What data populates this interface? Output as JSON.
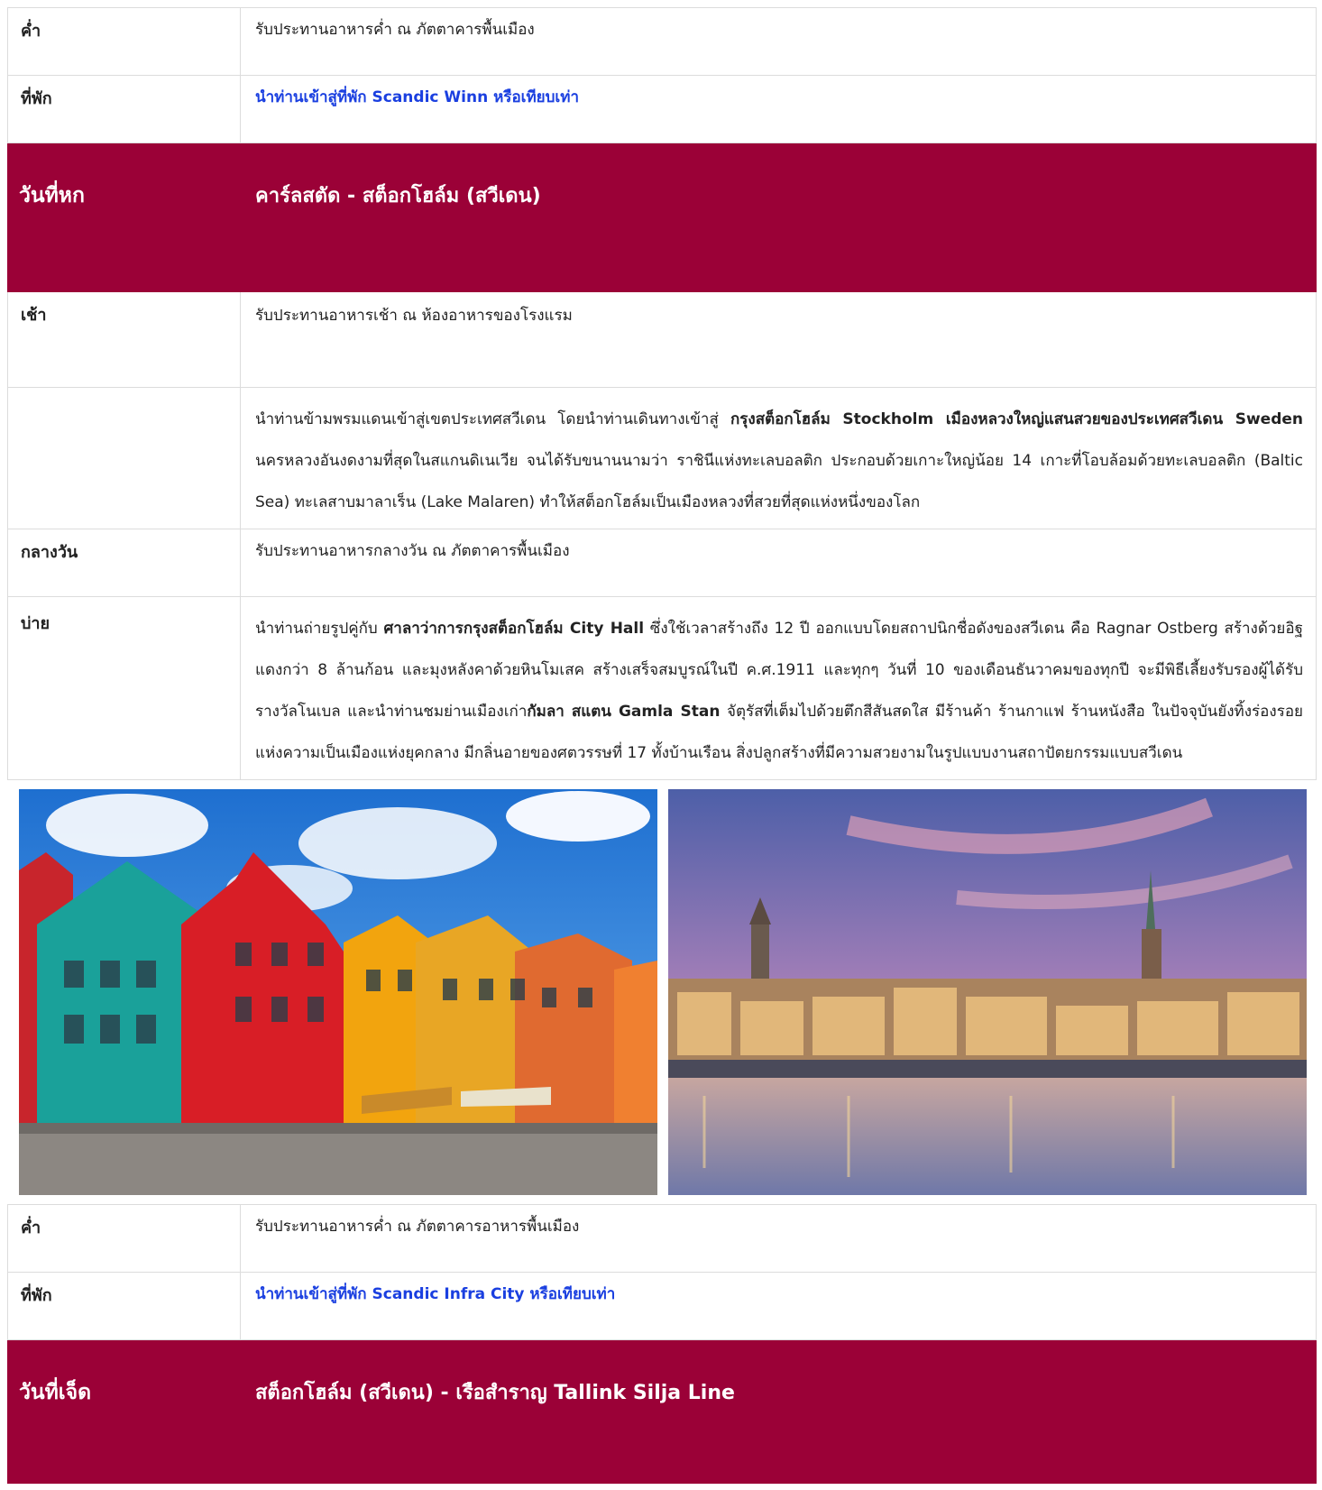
{
  "rows": {
    "dinner1": {
      "label": "ค่ำ",
      "text": "รับประทานอาหารค่ำ ณ ภัตตาคารพื้นเมือง"
    },
    "hotel1": {
      "label": "ที่พัก",
      "text": "นำท่านเข้าสู่ที่พัก Scandic Winn หรือเทียบเท่า"
    },
    "day6": {
      "label": "วันที่หก",
      "title": "คาร์ลสตัด - สต็อกโฮล์ม (สวีเดน)"
    },
    "breakfast": {
      "label": "เช้า",
      "text": "รับประทานอาหารเช้า ณ ห้องอาหารของโรงแรม"
    },
    "morning_para": {
      "p1": "นำท่านข้ามพรมแดนเข้าสู่เขตประเทศสวีเดน โดยนำท่านเดินทางเข้าสู่ ",
      "b1": "กรุงสต็อกโฮล์ม Stockholm เมืองหลวงใหญ่แสนสวยของประเทศสวีเดน Sweden",
      "p2": " นครหลวงอันงดงามที่สุดในสแกนดิเนเวีย จนได้รับขนานนามว่า ราชินีแห่งทะเลบอลติก ประกอบด้วยเกาะใหญ่น้อย 14 เกาะที่โอบล้อมด้วยทะเลบอลติก (Baltic Sea) ทะเลสาบมาลาเร็น (Lake Malaren) ทำให้สต็อกโฮล์มเป็นเมืองหลวงที่สวยที่สุดแห่งหนึ่งของโลก"
    },
    "lunch": {
      "label": "กลางวัน",
      "text": "รับประทานอาหารกลางวัน ณ ภัตตาคารพื้นเมือง"
    },
    "afternoon": {
      "label": "บ่าย",
      "p1": "นำท่านถ่ายรูปคู่กับ ",
      "b1": "ศาลาว่าการกรุงสต็อกโฮล์ม City Hall",
      "p2": " ซึ่งใช้เวลาสร้างถึง 12 ปี ออกแบบโดยสถาปนิกชื่อดังของสวีเดน คือ Ragnar Ostberg สร้างด้วยอิฐแดงกว่า 8 ล้านก้อน และมุงหลังคาด้วยหินโมเสค สร้างเสร็จสมบูรณ์ในปี ค.ศ.1911 และทุกๆ วันที่ 10 ของเดือนธันวาคมของทุกปี จะมีพิธีเลี้ยงรับรองผู้ได้รับรางวัลโนเบล และนำท่านชมย่านเมืองเก่า",
      "b2": "กัมลา สแตน Gamla Stan",
      "p3": " จัตุรัสที่เต็มไปด้วยตึกสีสันสดใส มีร้านค้า ร้านกาแฟ ร้านหนังสือ ในปัจจุบันยังทิ้งร่องรอยแห่งความเป็นเมืองแห่งยุคกลาง มีกลิ่นอายของศตวรรษที่ 17 ทั้งบ้านเรือน สิ่งปลูกสร้างที่มีความสวยงามในรูปแบบงานสถาปัตยกรรมแบบสวีเดน"
    },
    "dinner2": {
      "label": "ค่ำ",
      "text": "รับประทานอาหารค่ำ ณ ภัตตาคารอาหารพื้นเมือง"
    },
    "hotel2": {
      "label": "ที่พัก",
      "text": "นำท่านเข้าสู่ที่พัก Scandic Infra City หรือเทียบเท่า"
    },
    "day7": {
      "label": "วันที่เจ็ด",
      "title": "สต็อกโฮล์ม (สวีเดน) - เรือสำราญ Tallink Silja Line"
    }
  },
  "colors": {
    "header_bg": "#9b0137",
    "link_blue": "#1a3fe0",
    "border": "#dcdcdc"
  }
}
